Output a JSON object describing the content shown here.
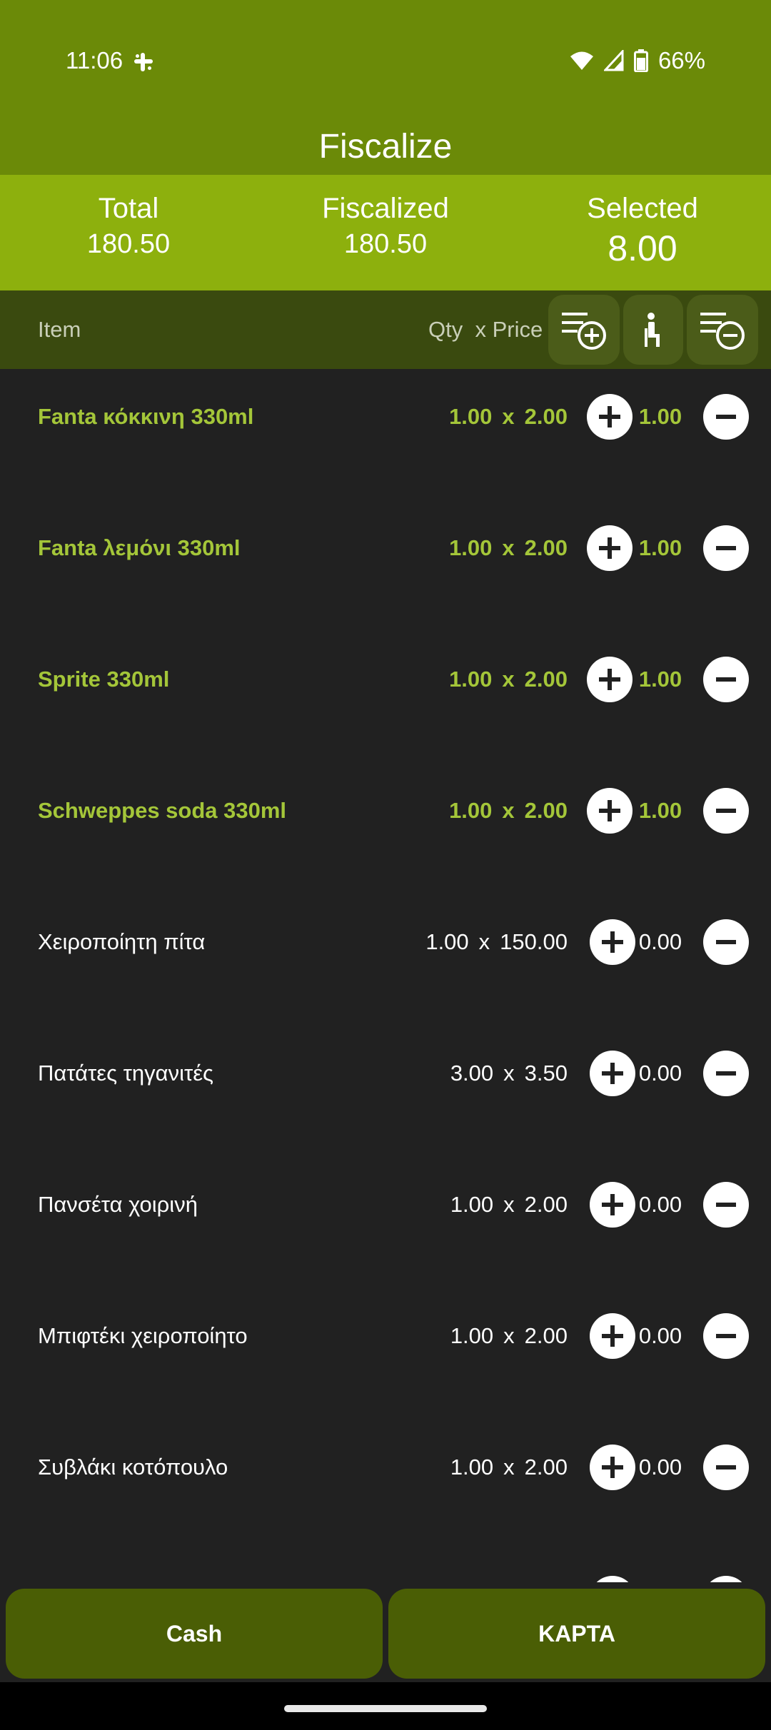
{
  "status_bar": {
    "time": "11:06",
    "battery": "66%"
  },
  "header": {
    "title": "Fiscalize"
  },
  "summary": {
    "total_label": "Total",
    "total_value": "180.50",
    "fiscalized_label": "Fiscalized",
    "fiscalized_value": "180.50",
    "selected_label": "Selected",
    "selected_value": "8.00"
  },
  "columns": {
    "item": "Item",
    "qty": "Qty",
    "x": "x",
    "price": "Price"
  },
  "items": [
    {
      "name": "Fanta κόκκινη 330ml",
      "qty": "1.00",
      "x": "x",
      "price": "2.00",
      "selected": "1.00"
    },
    {
      "name": "Fanta λεμόνι 330ml",
      "qty": "1.00",
      "x": "x",
      "price": "2.00",
      "selected": "1.00"
    },
    {
      "name": "Sprite 330ml",
      "qty": "1.00",
      "x": "x",
      "price": "2.00",
      "selected": "1.00"
    },
    {
      "name": "Schweppes soda 330ml",
      "qty": "1.00",
      "x": "x",
      "price": "2.00",
      "selected": "1.00"
    },
    {
      "name": "Χειροποίητη πίτα",
      "qty": "1.00",
      "x": "x",
      "price": "150.00",
      "selected": "0.00"
    },
    {
      "name": "Πατάτες τηγανιτές",
      "qty": "3.00",
      "x": "x",
      "price": "3.50",
      "selected": "0.00"
    },
    {
      "name": "Πανσέτα χοιρινή",
      "qty": "1.00",
      "x": "x",
      "price": "2.00",
      "selected": "0.00"
    },
    {
      "name": "Μπιφτέκι χειροποίητο",
      "qty": "1.00",
      "x": "x",
      "price": "2.00",
      "selected": "0.00"
    },
    {
      "name": "Συβλάκι κοτόπουλο",
      "qty": "1.00",
      "x": "x",
      "price": "2.00",
      "selected": "0.00"
    }
  ],
  "buttons": {
    "cash": "Cash",
    "card": "ΚΑΡΤΑ"
  },
  "colors": {
    "header": "#6b8a08",
    "summary": "#8db00d",
    "accent": "#a4c639",
    "button": "#4a5e05"
  }
}
